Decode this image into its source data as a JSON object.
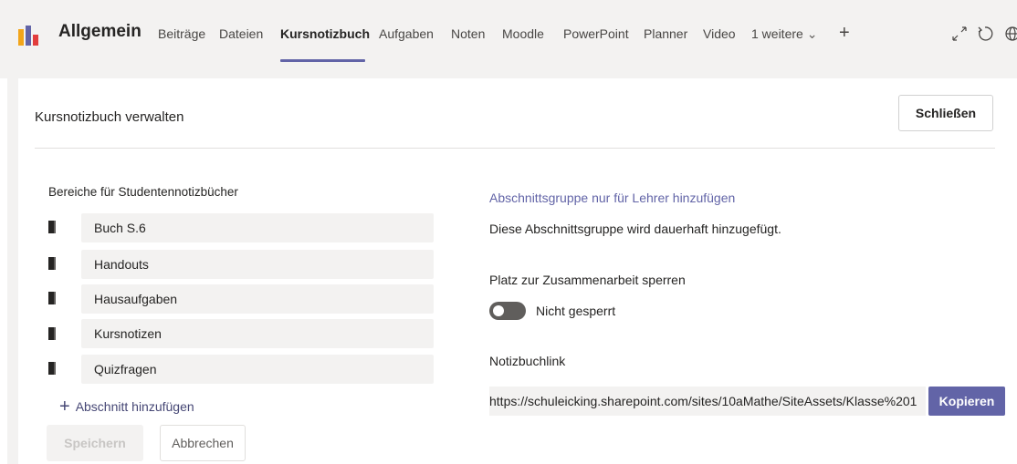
{
  "header": {
    "channel_name": "Allgemein",
    "tabs": [
      {
        "label": "Beiträge"
      },
      {
        "label": "Dateien"
      },
      {
        "label": "Kursnotizbuch"
      },
      {
        "label": "Aufgaben"
      },
      {
        "label": "Noten"
      },
      {
        "label": "Moodle"
      },
      {
        "label": "PowerPoint"
      },
      {
        "label": "Planner"
      },
      {
        "label": "Video"
      },
      {
        "label": "1 weitere"
      }
    ],
    "active_tab": "Kursnotizbuch",
    "more_chevron": "⌄",
    "add_tab": "+",
    "icons": [
      "app-logo-icon",
      "expand-icon",
      "refresh-icon",
      "globe-icon"
    ]
  },
  "panel": {
    "title": "Kursnotizbuch verwalten",
    "close_label": "Schließen",
    "student_sections_label": "Bereiche für Studentennotizbücher",
    "sections": [
      {
        "label": "Buch S.6"
      },
      {
        "label": "Handouts"
      },
      {
        "label": "Hausaufgaben"
      },
      {
        "label": "Kursnotizen"
      },
      {
        "label": "Quizfragen"
      }
    ],
    "add_section_label": "Abschnitt hinzufügen",
    "save_label": "Speichern",
    "cancel_label": "Abbrechen",
    "teacher_group_link": "Abschnittsgruppe nur für Lehrer hinzufügen",
    "teacher_group_desc": "Diese Abschnittsgruppe wird dauerhaft hinzugefügt.",
    "lock_label": "Platz zur Zusammenarbeit sperren",
    "lock_state": "Nicht gesperrt",
    "notebook_link_label": "Notizbuchlink",
    "notebook_link_value": "https://schuleicking.sharepoint.com/sites/10aMathe/SiteAssets/Klasse%201",
    "copy_label": "Kopieren"
  },
  "colors": {
    "accent": "#6264a7",
    "background": "#f3f2f1"
  }
}
